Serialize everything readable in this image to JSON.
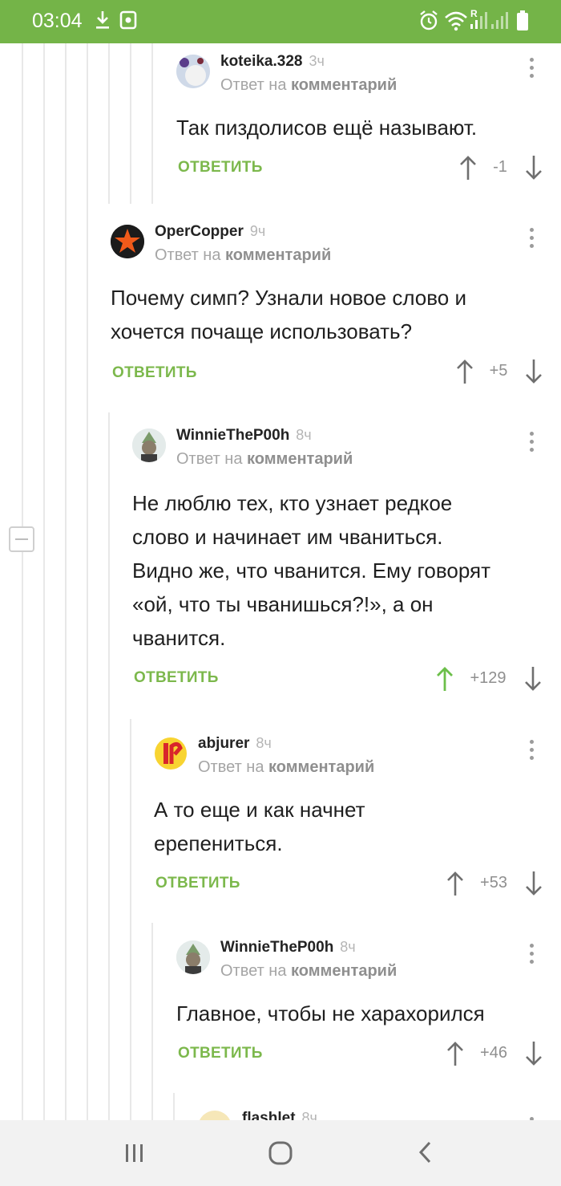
{
  "status_bar": {
    "time": "03:04",
    "signal_label": "R"
  },
  "comments": [
    {
      "username": "koteika.328",
      "time": "3ч",
      "reply_prefix": "Ответ на",
      "reply_target": "комментарий",
      "text_lines": [
        "Так пиздолисов ещё называют."
      ],
      "reply_label": "ОТВЕТИТЬ",
      "score": "-1"
    },
    {
      "username": "OperCopper",
      "time": "9ч",
      "reply_prefix": "Ответ на",
      "reply_target": "комментарий",
      "text_lines": [
        "Почему симп? Узнали новое слово и",
        "хочется почаще использовать?"
      ],
      "reply_label": "ОТВЕТИТЬ",
      "score": "+5"
    },
    {
      "username": "WinnieTheP00h",
      "time": "8ч",
      "reply_prefix": "Ответ на",
      "reply_target": "комментарий",
      "text_lines": [
        "Не люблю тех, кто узнает редкое",
        "слово и начинает им чваниться.",
        "Видно же, что чванится. Ему говорят",
        "«ой, что ты чванишься?!», а он",
        "чванится."
      ],
      "reply_label": "ОТВЕТИТЬ",
      "score": "+129"
    },
    {
      "username": "abjurer",
      "time": "8ч",
      "reply_prefix": "Ответ на",
      "reply_target": "комментарий",
      "text_lines": [
        "А то еще и как начнет",
        "ерепениться."
      ],
      "reply_label": "ОТВЕТИТЬ",
      "score": "+53"
    },
    {
      "username": "WinnieTheP00h",
      "time": "8ч",
      "reply_prefix": "Ответ на",
      "reply_target": "комментарий",
      "text_lines": [
        "Главное, чтобы не харахорился"
      ],
      "reply_label": "ОТВЕТИТЬ",
      "score": "+46"
    },
    {
      "username": "flashlet",
      "time": "8ч"
    }
  ],
  "colors": {
    "accent": "#74b448",
    "reply_green": "#7cb84c",
    "upvoted": "#6cbf4a",
    "muted": "#8f8f8f"
  },
  "icons": {
    "vote_up": "arrow-up-icon",
    "vote_down": "arrow-down-icon",
    "more": "more-vertical-icon",
    "nav_recent": "recent-apps-icon",
    "nav_home": "home-icon",
    "nav_back": "back-icon"
  }
}
